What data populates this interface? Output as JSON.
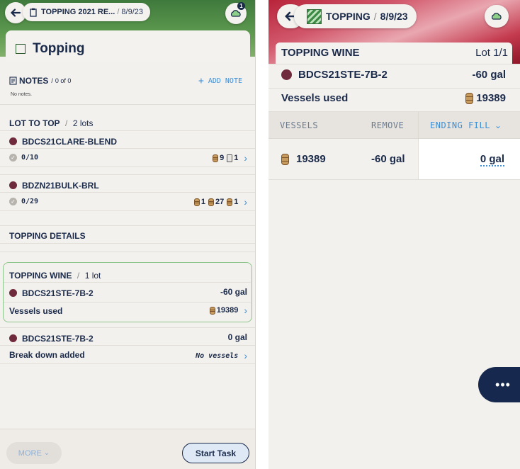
{
  "left": {
    "header": {
      "title": "TOPPING 2021 RE...",
      "date": "8/9/23",
      "badge_count": "1"
    },
    "task_title": "Topping",
    "notes": {
      "label": "NOTES",
      "count": "0 of 0",
      "add_label": "ADD NOTE",
      "empty_text": "No notes."
    },
    "lot_to_top": {
      "label": "LOT TO TOP",
      "count": "2 lots",
      "lots": [
        {
          "name": "BDCS21CLARE-BLEND",
          "progress": "0/10",
          "barrels": "9",
          "tanks": "1"
        },
        {
          "name": "BDZN21BULK-BRL",
          "progress": "0/29",
          "chip1": "1",
          "chip2": "27",
          "chip3": "1"
        }
      ]
    },
    "topping_details": {
      "label": "TOPPING DETAILS"
    },
    "topping_wine": {
      "label": "TOPPING WINE",
      "count": "1 lot",
      "lot_name": "BDCS21STE-7B-2",
      "volume": "-60 gal",
      "vessels_label": "Vessels used",
      "vessel_id": "19389"
    },
    "breakdown": {
      "lot_name": "BDCS21STE-7B-2",
      "volume": "0 gal",
      "label": "Break down added",
      "value": "No vessels"
    },
    "footer": {
      "more_label": "MORE",
      "start_label": "Start Task"
    }
  },
  "right": {
    "header": {
      "title": "TOPPING",
      "date": "8/9/23"
    },
    "section": {
      "label": "TOPPING WINE",
      "lot_counter": "Lot 1/1"
    },
    "lot": {
      "name": "BDCS21STE-7B-2",
      "volume": "-60 gal"
    },
    "vessels_used": {
      "label": "Vessels used",
      "vessel_id": "19389"
    },
    "table": {
      "headers": {
        "vessels": "VESSELS",
        "remove": "REMOVE",
        "ending_fill": "ENDING FILL"
      },
      "rows": [
        {
          "vessel": "19389",
          "remove": "-60 gal",
          "ending_fill": "0 gal"
        }
      ]
    },
    "fab_label": "•••"
  },
  "colors": {
    "accent": "#3a8fd8",
    "navy": "#1a2a4a",
    "wine_dot": "#6f2a3b",
    "green_border": "#8ec58c"
  }
}
